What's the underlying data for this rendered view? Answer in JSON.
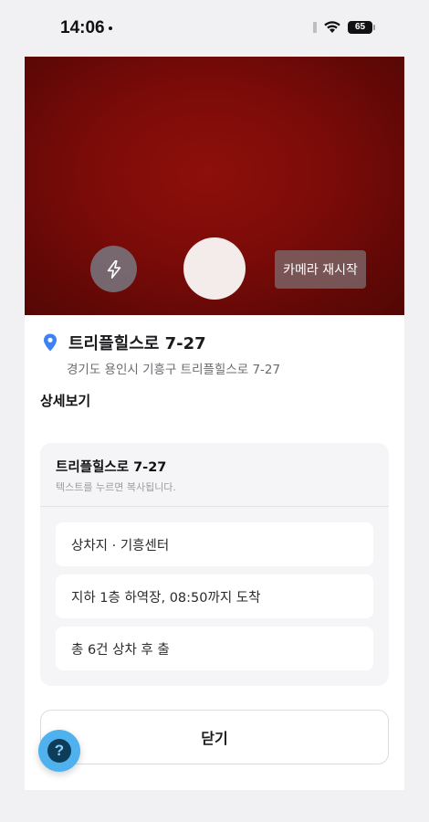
{
  "status_bar": {
    "time": "14:06",
    "battery": "65"
  },
  "camera": {
    "restart_label": "카메라 재시작"
  },
  "location": {
    "title": "트리플힐스로 7-27",
    "address": "경기도 용인시 기흥구 트리플힐스로 7-27"
  },
  "detail": {
    "heading": "상세보기",
    "card_title": "트리플힐스로 7-27",
    "card_hint": "텍스트를 누르면 복사됩니다.",
    "items": [
      {
        "text": "상차지 · 기흥센터"
      },
      {
        "text": "지하 1층 하역장, 08:50까지 도착"
      },
      {
        "text": "총 6건 상차 후 출"
      }
    ]
  },
  "close_label": "닫기",
  "help_label": "?",
  "colors": {
    "accent": "#4fb2ee",
    "pin": "#3b82f6",
    "camera_bg": "#7a0b08"
  }
}
